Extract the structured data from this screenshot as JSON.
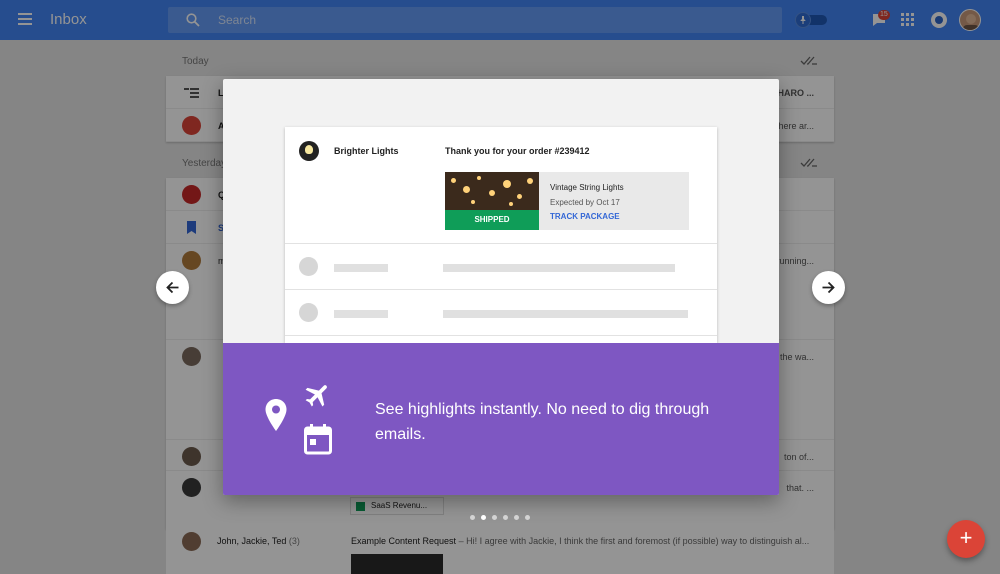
{
  "header": {
    "title": "Inbox",
    "search_placeholder": "Search",
    "reminders_badge": "15"
  },
  "inbox": {
    "sections": [
      {
        "label": "Today",
        "rows": [
          {
            "sender": "L",
            "snippet": "HARO ..."
          },
          {
            "sender": "A",
            "snippet": "here ar..."
          }
        ]
      },
      {
        "label": "Yesterday",
        "rows": [
          {
            "sender": "Q",
            "snippet": ""
          },
          {
            "sender": "S",
            "snippet": ""
          },
          {
            "sender": "m",
            "snippet": "running..."
          }
        ]
      }
    ],
    "partial_snippets": [
      "the wa...",
      "ton of...",
      "that. ..."
    ],
    "attachment_chip": "SaaS Revenu...",
    "bottom_row": {
      "sender": "John, Jackie, Ted",
      "count": "(3)",
      "subject": "Example Content Request",
      "snippet": " – Hi! I agree with Jackie, I think the first and foremost (if possible) way to distinguish al..."
    }
  },
  "dialog": {
    "preview": {
      "sender": "Brighter Lights",
      "subject": "Thank you for your order #239412",
      "highlight": {
        "status": "SHIPPED",
        "title": "Vintage String Lights",
        "subtitle": "Expected by Oct 17",
        "action": "TRACK PACKAGE"
      }
    },
    "message": "See highlights instantly. No need to dig through emails.",
    "pager": {
      "total": 6,
      "active": 1
    }
  },
  "colors": {
    "app_bar": "#4285f4",
    "promo": "#7e57c2",
    "shipped": "#0f9d58",
    "link": "#3367d6",
    "fab": "#db4437"
  },
  "icons": [
    "menu-icon",
    "search-icon",
    "pin-icon",
    "reminder-icon",
    "apps-icon",
    "notifications-icon",
    "sweep-icon",
    "arrow-back-icon",
    "arrow-forward-icon",
    "location-icon",
    "flight-icon",
    "calendar-icon",
    "add-icon"
  ]
}
